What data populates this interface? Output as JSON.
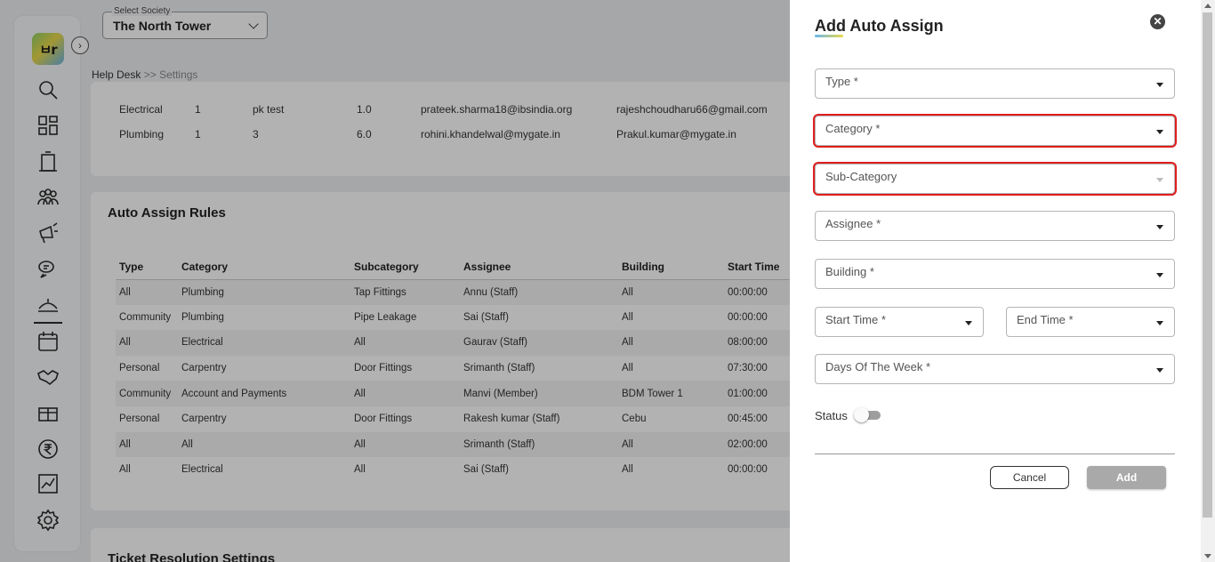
{
  "header": {
    "society_label": "Select Society",
    "society_value": "The North Tower",
    "breadcrumb_root": "Help Desk",
    "breadcrumb_sep": ">>",
    "breadcrumb_current": "Settings"
  },
  "escalation": {
    "rows": [
      {
        "category": "Electrical",
        "level": "1",
        "assignee": "pk test",
        "time": "1.0",
        "email1": "prateek.sharma18@ibsindia.org",
        "email2": "rajeshchoudharu66@gmail.com"
      },
      {
        "category": "Plumbing",
        "level": "1",
        "assignee": "3",
        "time": "6.0",
        "email1": "rohini.khandelwal@mygate.in",
        "email2": "Prakul.kumar@mygate.in"
      }
    ]
  },
  "auto_assign": {
    "title": "Auto Assign Rules",
    "columns": [
      "Type",
      "Category",
      "Subcategory",
      "Assignee",
      "Building",
      "Start Time"
    ],
    "rows": [
      [
        "All",
        "Plumbing",
        "Tap Fittings",
        "Annu (Staff)",
        "All",
        "00:00:00"
      ],
      [
        "Community",
        "Plumbing",
        "Pipe Leakage",
        "Sai (Staff)",
        "All",
        "00:00:00"
      ],
      [
        "All",
        "Electrical",
        "All",
        "Gaurav (Staff)",
        "All",
        "08:00:00"
      ],
      [
        "Personal",
        "Carpentry",
        "Door Fittings",
        "Srimanth (Staff)",
        "All",
        "07:30:00"
      ],
      [
        "Community",
        "Account and Payments",
        "All",
        "Manvi (Member)",
        "BDM Tower 1",
        "01:00:00"
      ],
      [
        "Personal",
        "Carpentry",
        "Door Fittings",
        "Rakesh kumar (Staff)",
        "Cebu",
        "00:45:00"
      ],
      [
        "All",
        "All",
        "All",
        "Srimanth (Staff)",
        "All",
        "02:00:00"
      ],
      [
        "All",
        "Electrical",
        "All",
        "Sai (Staff)",
        "All",
        "00:00:00"
      ]
    ]
  },
  "ticket_resolution": {
    "title": "Ticket Resolution Settings"
  },
  "drawer": {
    "title": "Add Auto Assign",
    "fields": {
      "type": "Type *",
      "category": "Category *",
      "subcategory": "Sub-Category",
      "assignee": "Assignee *",
      "building": "Building *",
      "start_time": "Start Time *",
      "end_time": "End Time *",
      "days": "Days Of The Week *"
    },
    "status_label": "Status",
    "status_on": false,
    "cancel_label": "Cancel",
    "add_label": "Add",
    "close_glyph": "✕"
  },
  "icons": {
    "logo_text": "ㅂr",
    "nav": [
      "search-icon",
      "dashboard-icon",
      "building-icon",
      "community-icon",
      "announcement-icon",
      "chat-icon",
      "helpdesk-icon",
      "calendar-icon",
      "handshake-icon",
      "amenity-icon",
      "rupee-icon",
      "reports-icon",
      "settings-icon"
    ]
  },
  "colors": {
    "highlight": "#e01e1e",
    "add_button": "#a9a9a9",
    "overlay": "rgba(0,0,0,0.30)"
  }
}
